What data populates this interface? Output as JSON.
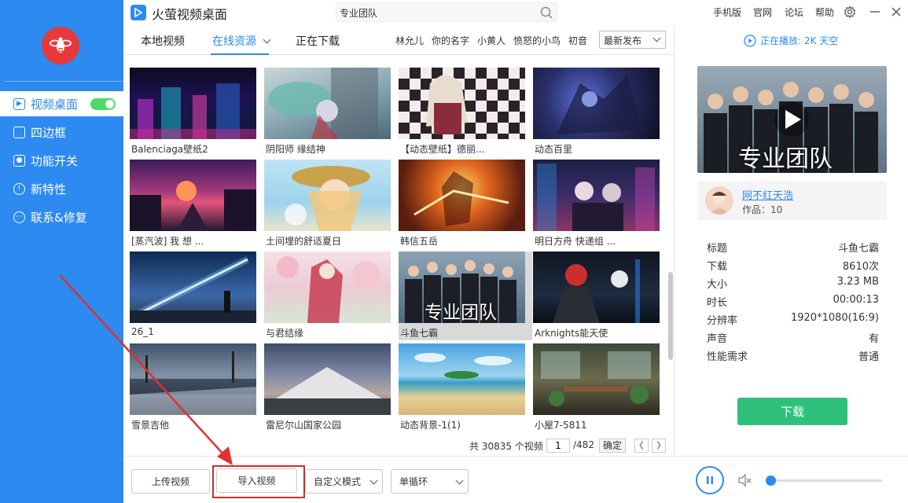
{
  "window": {
    "title": "火萤视频桌面"
  },
  "sidebar": {
    "items": [
      {
        "label": "视频桌面",
        "active": true,
        "icon": "play-square-icon",
        "toggle_on": true
      },
      {
        "label": "四边框",
        "icon": "square-icon"
      },
      {
        "label": "功能开关",
        "icon": "toggle-icon"
      },
      {
        "label": "新特性",
        "icon": "bulb-icon"
      },
      {
        "label": "联系&修复",
        "icon": "dots-icon"
      }
    ]
  },
  "search": {
    "value": "专业团队"
  },
  "top_menu": {
    "mobile": "手机版",
    "website": "官网",
    "forum": "论坛",
    "help": "帮助"
  },
  "tabs": [
    {
      "label": "本地视频"
    },
    {
      "label": "在线资源",
      "active": true
    },
    {
      "label": "正在下载"
    }
  ],
  "filter_tags": [
    "林允儿",
    "你的名字",
    "小黄人",
    "愤怒的小鸟",
    "初音"
  ],
  "sort": {
    "selected": "最新发布"
  },
  "videos": [
    {
      "title": "Balenciaga壁纸2"
    },
    {
      "title": "阴阳师  缘结神"
    },
    {
      "title": "【动态壁纸】德丽..."
    },
    {
      "title": "动态百里"
    },
    {
      "title": "[蒸汽波] 我 想 ..."
    },
    {
      "title": "土间埋的舒适夏日"
    },
    {
      "title": "韩信五岳"
    },
    {
      "title": "明日方舟 快递组 ..."
    },
    {
      "title": "26_1"
    },
    {
      "title": "与君结缘"
    },
    {
      "title": "斗鱼七霸",
      "selected": true,
      "overlay": "专业团队"
    },
    {
      "title": "Arknights能天使"
    },
    {
      "title": "雪景吉他"
    },
    {
      "title": "雷尼尔山国家公园"
    },
    {
      "title": "动态背景-1(1)"
    },
    {
      "title": "小屋7-5811"
    }
  ],
  "pager": {
    "total_text": "共 30835 个视频",
    "current_page": "1",
    "max_text": "/482",
    "go_label": "确定"
  },
  "bottom": {
    "upload": "上传视频",
    "import": "导入视频",
    "mode": "自定义模式",
    "loop": "单循环"
  },
  "volume": {
    "level": 0.02
  },
  "player": {
    "now_playing": "正在播放: 2K 天空",
    "preview_overlay": "专业团队",
    "author": {
      "name": "网不红天浩",
      "works": "作品：10"
    },
    "info": [
      {
        "key": "标题",
        "value": "斗鱼七霸"
      },
      {
        "key": "下载",
        "value": "8610次"
      },
      {
        "key": "大小",
        "value": "3.23 MB"
      },
      {
        "key": "时长",
        "value": "00:00:13"
      },
      {
        "key": "分辨率",
        "value": "1920*1080(16:9)"
      },
      {
        "key": "声音",
        "value": "有"
      },
      {
        "key": "性能需求",
        "value": "普通"
      }
    ],
    "download_label": "下载"
  },
  "colors": {
    "accent": "#2c8af0",
    "sidebar_bg": "#2c8af0",
    "download_green": "#2fc17c",
    "highlight_red": "#c9302c",
    "logo_red": "#e8393a"
  }
}
